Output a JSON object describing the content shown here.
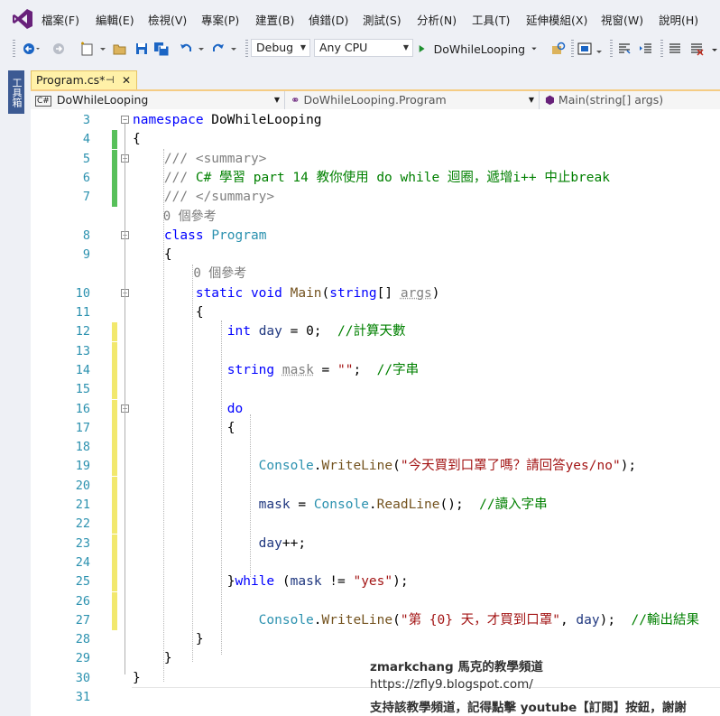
{
  "menu": [
    "檔案(F)",
    "編輯(E)",
    "檢視(V)",
    "專案(P)",
    "建置(B)",
    "偵錯(D)",
    "測試(S)",
    "分析(N)",
    "工具(T)",
    "延伸模組(X)",
    "視窗(W)",
    "說明(H)"
  ],
  "toolbar": {
    "config": "Debug",
    "platform": "Any CPU",
    "start_target": "DoWhileLooping"
  },
  "side_panel_label": "工具箱",
  "tab": {
    "title": "Program.cs*",
    "pin": "⊣",
    "close": "✕"
  },
  "nav": {
    "project": "DoWhileLooping",
    "class": "DoWhileLooping.Program",
    "member": "Main(string[] args)",
    "project_badge": "C#"
  },
  "colors": {
    "keyword": "#0000ff",
    "type": "#2b91af",
    "comment": "#008000",
    "string": "#a31515",
    "lineno": "#2b91af",
    "added": "#57c05a",
    "modified": "#f2e86d",
    "accent": "#68217a"
  },
  "code": [
    {
      "n": "3",
      "tokens": [
        {
          "t": "namespace",
          "c": "keyword"
        },
        {
          "t": " DoWhileLooping",
          "c": "plain"
        }
      ]
    },
    {
      "n": "4",
      "tokens": [
        {
          "t": "{",
          "c": "plain"
        }
      ]
    },
    {
      "n": "5",
      "tokens": [
        {
          "t": "    /// <summary>",
          "c": "gray"
        }
      ]
    },
    {
      "n": "6",
      "tokens": [
        {
          "t": "    /// ",
          "c": "gray"
        },
        {
          "t": "C# 學習 part 14 教你使用 do while 迴圈，遞增i++ 中止break",
          "c": "comment"
        }
      ]
    },
    {
      "n": "7",
      "tokens": [
        {
          "t": "    /// </summary>",
          "c": "gray"
        }
      ]
    },
    {
      "n": "",
      "tokens": [
        {
          "t": "    0 個參考",
          "c": "ref"
        }
      ]
    },
    {
      "n": "8",
      "tokens": [
        {
          "t": "    class ",
          "c": "keyword"
        },
        {
          "t": "Program",
          "c": "type"
        }
      ]
    },
    {
      "n": "9",
      "tokens": [
        {
          "t": "    {",
          "c": "plain"
        }
      ]
    },
    {
      "n": "",
      "tokens": [
        {
          "t": "        0 個參考",
          "c": "ref"
        }
      ]
    },
    {
      "n": "10",
      "tokens": [
        {
          "t": "        static void ",
          "c": "keyword"
        },
        {
          "t": "Main",
          "c": "method"
        },
        {
          "t": "(",
          "c": "plain"
        },
        {
          "t": "string",
          "c": "keyword"
        },
        {
          "t": "[] ",
          "c": "plain"
        },
        {
          "t": "args",
          "c": "faded"
        },
        {
          "t": ")",
          "c": "plain"
        }
      ]
    },
    {
      "n": "11",
      "tokens": [
        {
          "t": "        {",
          "c": "plain"
        }
      ]
    },
    {
      "n": "12",
      "tokens": [
        {
          "t": "            int ",
          "c": "keyword"
        },
        {
          "t": "day",
          "c": "var"
        },
        {
          "t": " = 0;  ",
          "c": "plain"
        },
        {
          "t": "//計算天數",
          "c": "comment"
        }
      ]
    },
    {
      "n": "13",
      "tokens": []
    },
    {
      "n": "14",
      "tokens": [
        {
          "t": "            string ",
          "c": "keyword"
        },
        {
          "t": "mask",
          "c": "faded"
        },
        {
          "t": " = ",
          "c": "plain"
        },
        {
          "t": "\"\"",
          "c": "string"
        },
        {
          "t": ";  ",
          "c": "plain"
        },
        {
          "t": "//字串",
          "c": "comment"
        }
      ]
    },
    {
      "n": "15",
      "tokens": []
    },
    {
      "n": "16",
      "tokens": [
        {
          "t": "            do",
          "c": "keyword"
        }
      ]
    },
    {
      "n": "17",
      "tokens": [
        {
          "t": "            {",
          "c": "plain"
        }
      ]
    },
    {
      "n": "18",
      "tokens": []
    },
    {
      "n": "19",
      "tokens": [
        {
          "t": "                Console",
          "c": "type"
        },
        {
          "t": ".",
          "c": "plain"
        },
        {
          "t": "WriteLine",
          "c": "method"
        },
        {
          "t": "(",
          "c": "plain"
        },
        {
          "t": "\"今天買到口罩了嗎？請回答yes/no\"",
          "c": "string"
        },
        {
          "t": ");",
          "c": "plain"
        }
      ]
    },
    {
      "n": "20",
      "tokens": []
    },
    {
      "n": "21",
      "tokens": [
        {
          "t": "                mask",
          "c": "var"
        },
        {
          "t": " = ",
          "c": "plain"
        },
        {
          "t": "Console",
          "c": "type"
        },
        {
          "t": ".",
          "c": "plain"
        },
        {
          "t": "ReadLine",
          "c": "method"
        },
        {
          "t": "();  ",
          "c": "plain"
        },
        {
          "t": "//讀入字串",
          "c": "comment"
        }
      ]
    },
    {
      "n": "22",
      "tokens": []
    },
    {
      "n": "23",
      "tokens": [
        {
          "t": "                day",
          "c": "var"
        },
        {
          "t": "++;",
          "c": "plain"
        }
      ]
    },
    {
      "n": "24",
      "tokens": []
    },
    {
      "n": "25",
      "tokens": [
        {
          "t": "            }",
          "c": "plain"
        },
        {
          "t": "while",
          "c": "keyword"
        },
        {
          "t": " (",
          "c": "plain"
        },
        {
          "t": "mask",
          "c": "var"
        },
        {
          "t": " != ",
          "c": "plain"
        },
        {
          "t": "\"yes\"",
          "c": "string"
        },
        {
          "t": ");",
          "c": "plain"
        }
      ]
    },
    {
      "n": "26",
      "tokens": []
    },
    {
      "n": "27",
      "tokens": [
        {
          "t": "                Console",
          "c": "type"
        },
        {
          "t": ".",
          "c": "plain"
        },
        {
          "t": "WriteLine",
          "c": "method"
        },
        {
          "t": "(",
          "c": "plain"
        },
        {
          "t": "\"第 {0} 天，才買到口罩\"",
          "c": "string"
        },
        {
          "t": ", ",
          "c": "plain"
        },
        {
          "t": "day",
          "c": "var"
        },
        {
          "t": ");  ",
          "c": "plain"
        },
        {
          "t": "//輸出結果",
          "c": "comment"
        }
      ]
    },
    {
      "n": "28",
      "tokens": [
        {
          "t": "        }",
          "c": "plain"
        }
      ]
    },
    {
      "n": "29",
      "tokens": [
        {
          "t": "    }",
          "c": "plain"
        }
      ]
    },
    {
      "n": "30",
      "tokens": [
        {
          "t": "}",
          "c": "plain"
        }
      ]
    },
    {
      "n": "31",
      "tokens": []
    }
  ],
  "watermark": {
    "line1": "zmarkchang 馬克的教學頻道",
    "line2": "https://zfly9.blogspot.com/",
    "line3": "支持該教學頻道，記得點擊 youtube【訂閱】按鈕，謝謝"
  }
}
